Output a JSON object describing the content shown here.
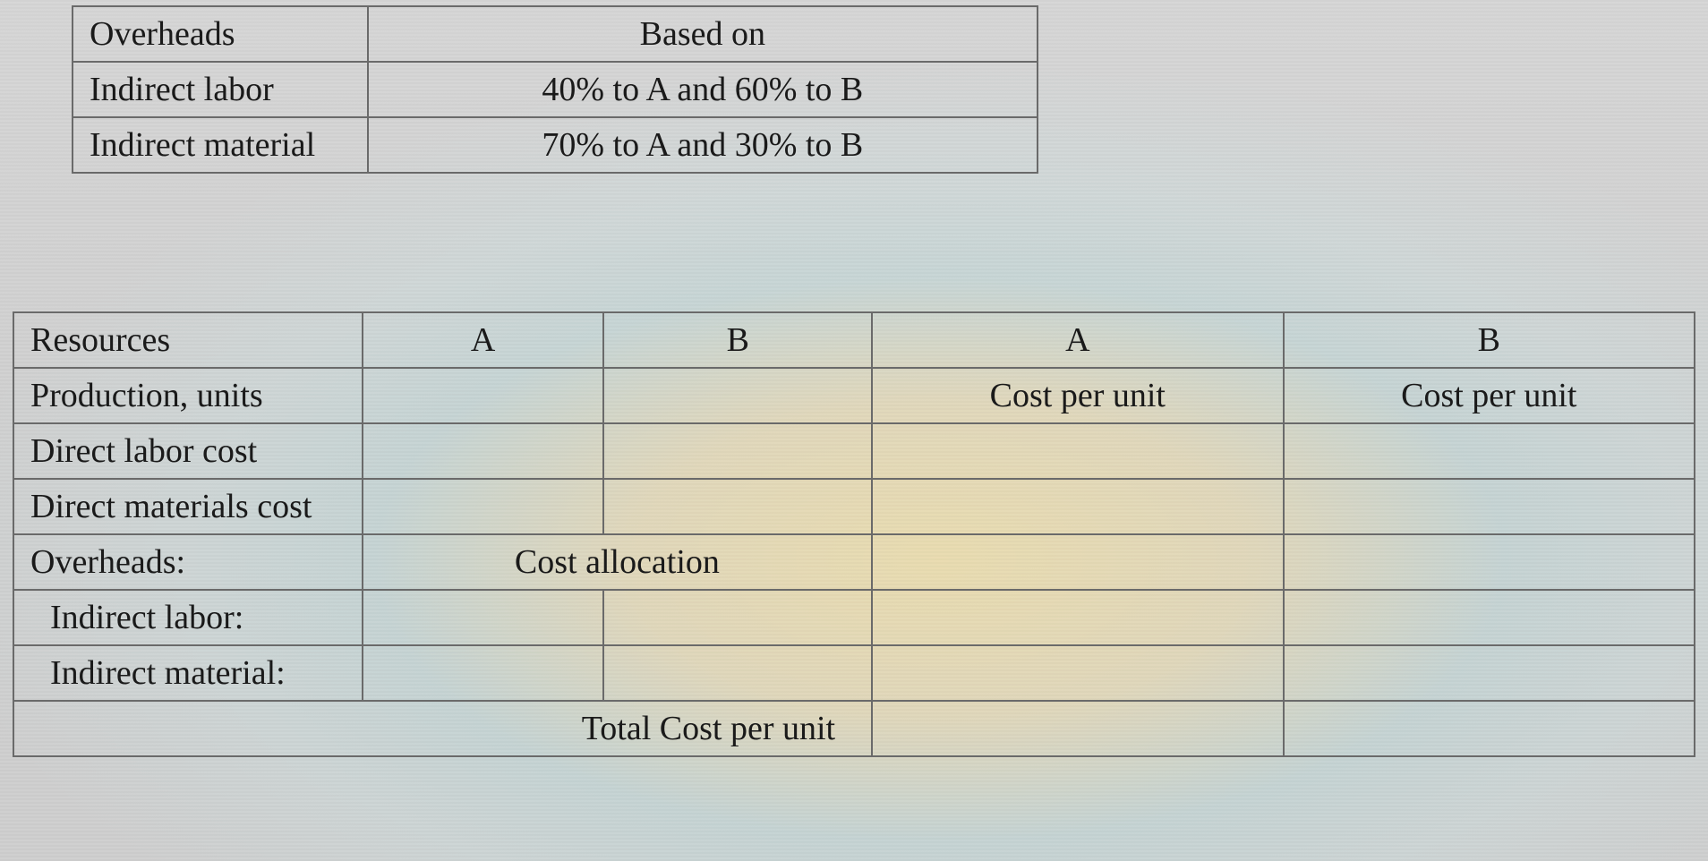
{
  "table1": {
    "headers": {
      "left": "Overheads",
      "right": "Based on"
    },
    "rows": [
      {
        "left": "Indirect labor",
        "right": "40% to A and 60% to B"
      },
      {
        "left": "Indirect material",
        "right": "70% to A and 30% to B"
      }
    ]
  },
  "table2": {
    "header": {
      "resources": "Resources",
      "a1": "A",
      "b1": "B",
      "a2": "A",
      "b2": "B"
    },
    "rows": {
      "production": {
        "label": "Production, units",
        "a1": "",
        "b1": "",
        "a2": "Cost per unit",
        "b2": "Cost per unit"
      },
      "direct_labor": {
        "label": "Direct labor cost",
        "a1": "",
        "b1": "",
        "a2": "",
        "b2": ""
      },
      "direct_materials": {
        "label": "Direct materials cost",
        "a1": "",
        "b1": "",
        "a2": "",
        "b2": ""
      },
      "overheads": {
        "label": "Overheads:",
        "span_ab1": "Cost allocation",
        "a2": "",
        "b2": ""
      },
      "indirect_labor": {
        "label": "Indirect labor:",
        "a1": "",
        "b1": "",
        "a2": "",
        "b2": ""
      },
      "indirect_material": {
        "label": "Indirect material:",
        "a1": "",
        "b1": "",
        "a2": "",
        "b2": ""
      },
      "total": {
        "span_label": "Total Cost per unit",
        "a2": "",
        "b2": ""
      }
    }
  }
}
